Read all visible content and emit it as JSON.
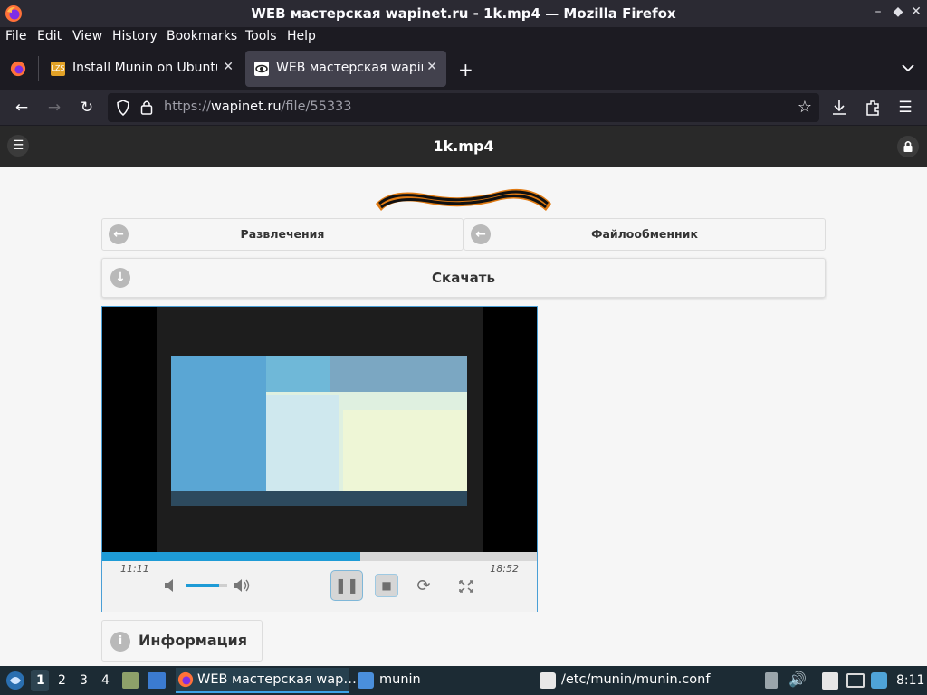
{
  "window": {
    "title": "WEB мастерская wapinet.ru - 1k.mp4 — Mozilla Firefox",
    "controls": [
      "–",
      "◆",
      "✕"
    ]
  },
  "menu": [
    "File",
    "Edit",
    "View",
    "History",
    "Bookmarks",
    "Tools",
    "Help"
  ],
  "tabs": [
    {
      "label": "Install Munin on Ubuntu",
      "favicon": "LZS",
      "active": false
    },
    {
      "label": "WEB мастерская wapinet",
      "favicon": "eye",
      "active": true
    }
  ],
  "address": {
    "prefix": "https://",
    "host": "wapinet.ru",
    "path": "/file/55333"
  },
  "site": {
    "header_title": "1k.mp4",
    "nav_left": "Развлечения",
    "nav_right": "Файлообменник",
    "download": "Скачать",
    "info": "Информация"
  },
  "player": {
    "current_time": "11:11",
    "duration": "18:52",
    "progress": 0.593,
    "volume": 0.8,
    "state": "playing"
  },
  "colors": {
    "accent": "#1e9bd6",
    "site_header": "#292929"
  },
  "taskbar": {
    "workspaces": [
      "1",
      "2",
      "3",
      "4"
    ],
    "tasks": [
      {
        "label": "WEB мастерская wap…",
        "icon": "firefox"
      },
      {
        "label": "munin",
        "icon": "folder"
      },
      {
        "label": "/etc/munin/munin.conf",
        "icon": "editor"
      }
    ],
    "clock": "8:11"
  }
}
